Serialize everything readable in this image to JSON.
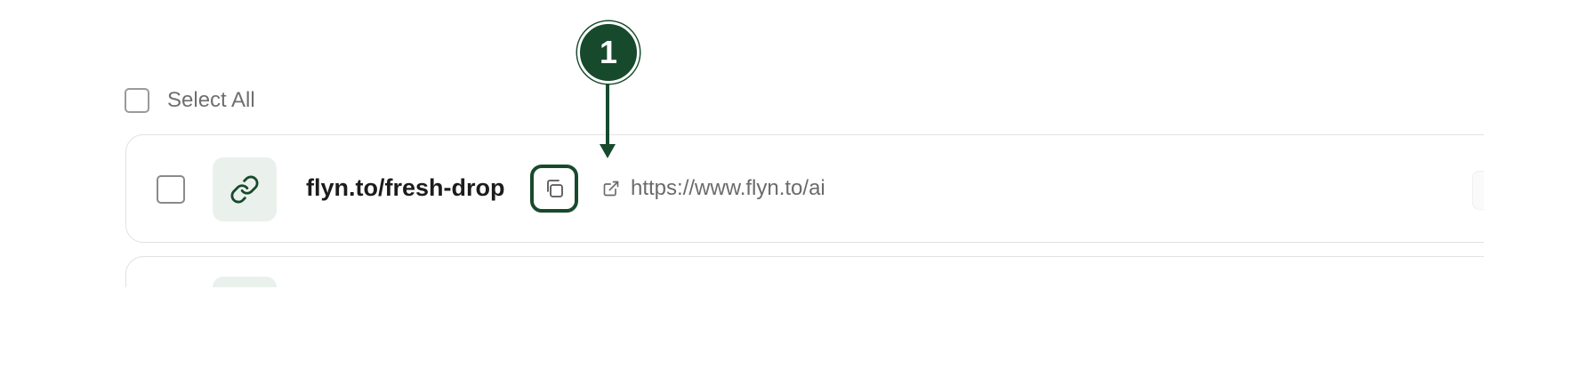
{
  "select_all": {
    "label": "Select All",
    "checked": false
  },
  "links": [
    {
      "short_url": "flyn.to/fresh-drop",
      "destination_url": "https://www.flyn.to/ai",
      "icon": "link-icon",
      "checked": false
    }
  ],
  "annotation": {
    "step_number": "1",
    "target": "copy-button"
  },
  "colors": {
    "accent": "#174a2d",
    "thumbnail_bg": "#eaf1ec",
    "card_border": "#e2e2e2",
    "muted_text": "#6b6b6b"
  },
  "icons": {
    "thumbnail": "link-icon",
    "copy": "copy-icon",
    "external": "external-link-icon"
  }
}
